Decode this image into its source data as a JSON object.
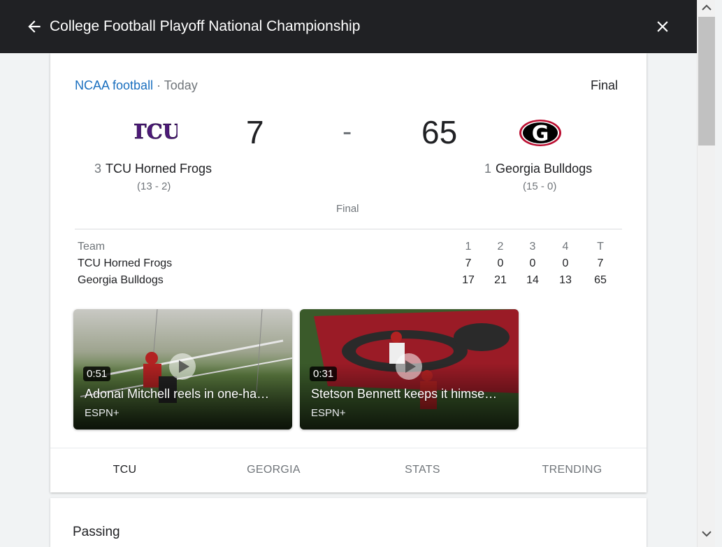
{
  "header": {
    "title": "College Football Playoff National Championship"
  },
  "game": {
    "league": "NCAA football",
    "separator": "·",
    "day": "Today",
    "status": "Final",
    "status_center": "Final",
    "score_separator": "-",
    "away": {
      "rank": "3",
      "name": "TCU Horned Frogs",
      "record": "(13 - 2)",
      "score": "7",
      "logo_text": "TCU",
      "color": "#4d1979"
    },
    "home": {
      "rank": "1",
      "name": "Georgia Bulldogs",
      "record": "(15 - 0)",
      "score": "65",
      "logo_text": "G",
      "color": "#ba0c2f"
    }
  },
  "linescore": {
    "headers": [
      "Team",
      "1",
      "2",
      "3",
      "4",
      "T"
    ],
    "rows": [
      [
        "TCU Horned Frogs",
        "7",
        "0",
        "0",
        "0",
        "7"
      ],
      [
        "Georgia Bulldogs",
        "17",
        "21",
        "14",
        "13",
        "65"
      ]
    ]
  },
  "videos": [
    {
      "duration": "0:51",
      "title": "Adonai Mitchell reels in one-ha…",
      "source": "ESPN+"
    },
    {
      "duration": "0:31",
      "title": "Stetson Bennett keeps it himse…",
      "source": "ESPN+"
    }
  ],
  "tabs": [
    {
      "label": "TCU",
      "active": true
    },
    {
      "label": "GEORGIA",
      "active": false
    },
    {
      "label": "STATS",
      "active": false
    },
    {
      "label": "TRENDING",
      "active": false
    }
  ],
  "section": {
    "heading": "Passing"
  },
  "icons": {
    "back": "back-arrow-icon",
    "close": "close-icon",
    "play": "play-icon"
  }
}
